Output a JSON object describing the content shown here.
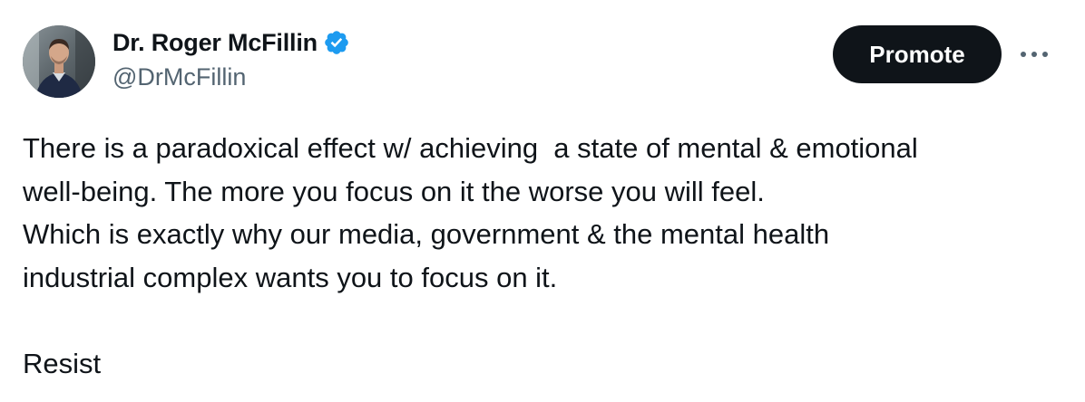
{
  "author": {
    "display_name": "Dr. Roger McFillin",
    "handle": "@DrMcFillin",
    "verified": true,
    "avatar_icon": "profile-photo"
  },
  "actions": {
    "promote_label": "Promote",
    "more_icon": "ellipsis-icon"
  },
  "post": {
    "lines": [
      "There is a paradoxical effect w/ achieving  a state of mental & emotional",
      "well-being. The more you focus on it the worse you will feel.",
      "Which is exactly why our media, government & the mental health",
      "industrial complex wants you to focus on it."
    ],
    "closing": "Resist"
  },
  "colors": {
    "verified_badge": "#1d9bf0",
    "promote_bg": "#0f1419",
    "handle": "#536471",
    "text": "#0f1419"
  }
}
